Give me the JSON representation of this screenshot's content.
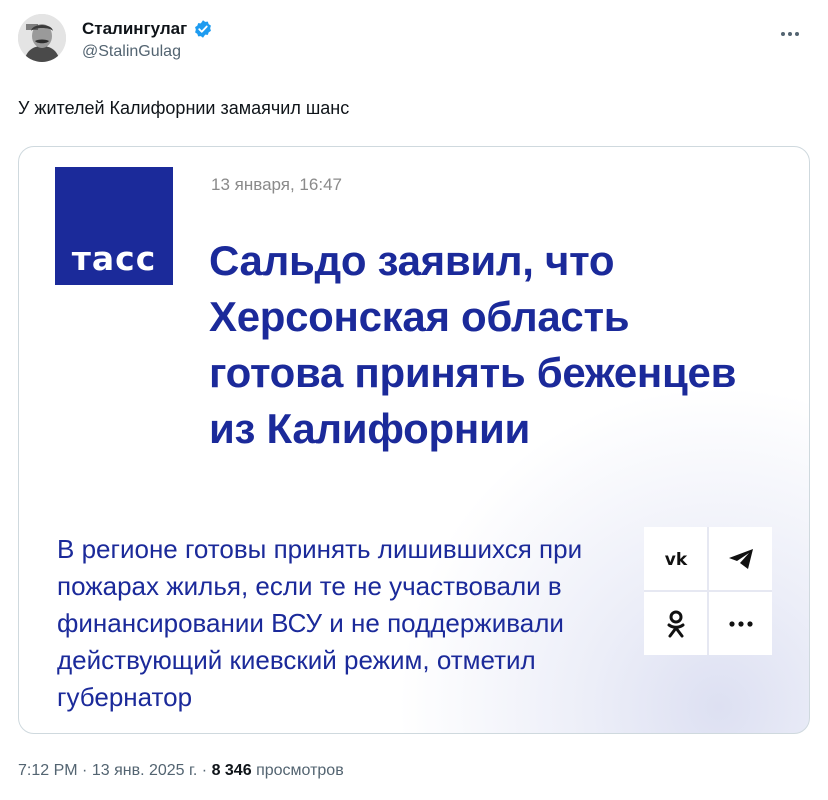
{
  "author": {
    "name": "Сталингулаг",
    "handle": "@StalinGulag",
    "verified_color": "#1d9bf0"
  },
  "tweet": {
    "text": "У жителей Калифорнии замаячил шанс"
  },
  "card": {
    "logo_text": "тасс",
    "date": "13 января, 16:47",
    "headline": "Сальдо заявил, что Херсонская область готова принять беженцев из Калифорнии",
    "lead": "В регионе готовы принять лишившихся при пожарах жилья, если те не участвовали в финансировании ВСУ и не поддерживали действующий киевский режим, отметил губернатор",
    "share_icons": [
      "vk-icon",
      "telegram-icon",
      "odnoklassniki-icon",
      "more-dots-icon"
    ],
    "brand_color": "#1b2a9a"
  },
  "meta": {
    "time": "7:12 PM",
    "date": "13 янв. 2025 г.",
    "views_count": "8 346",
    "views_label": "просмотров"
  }
}
